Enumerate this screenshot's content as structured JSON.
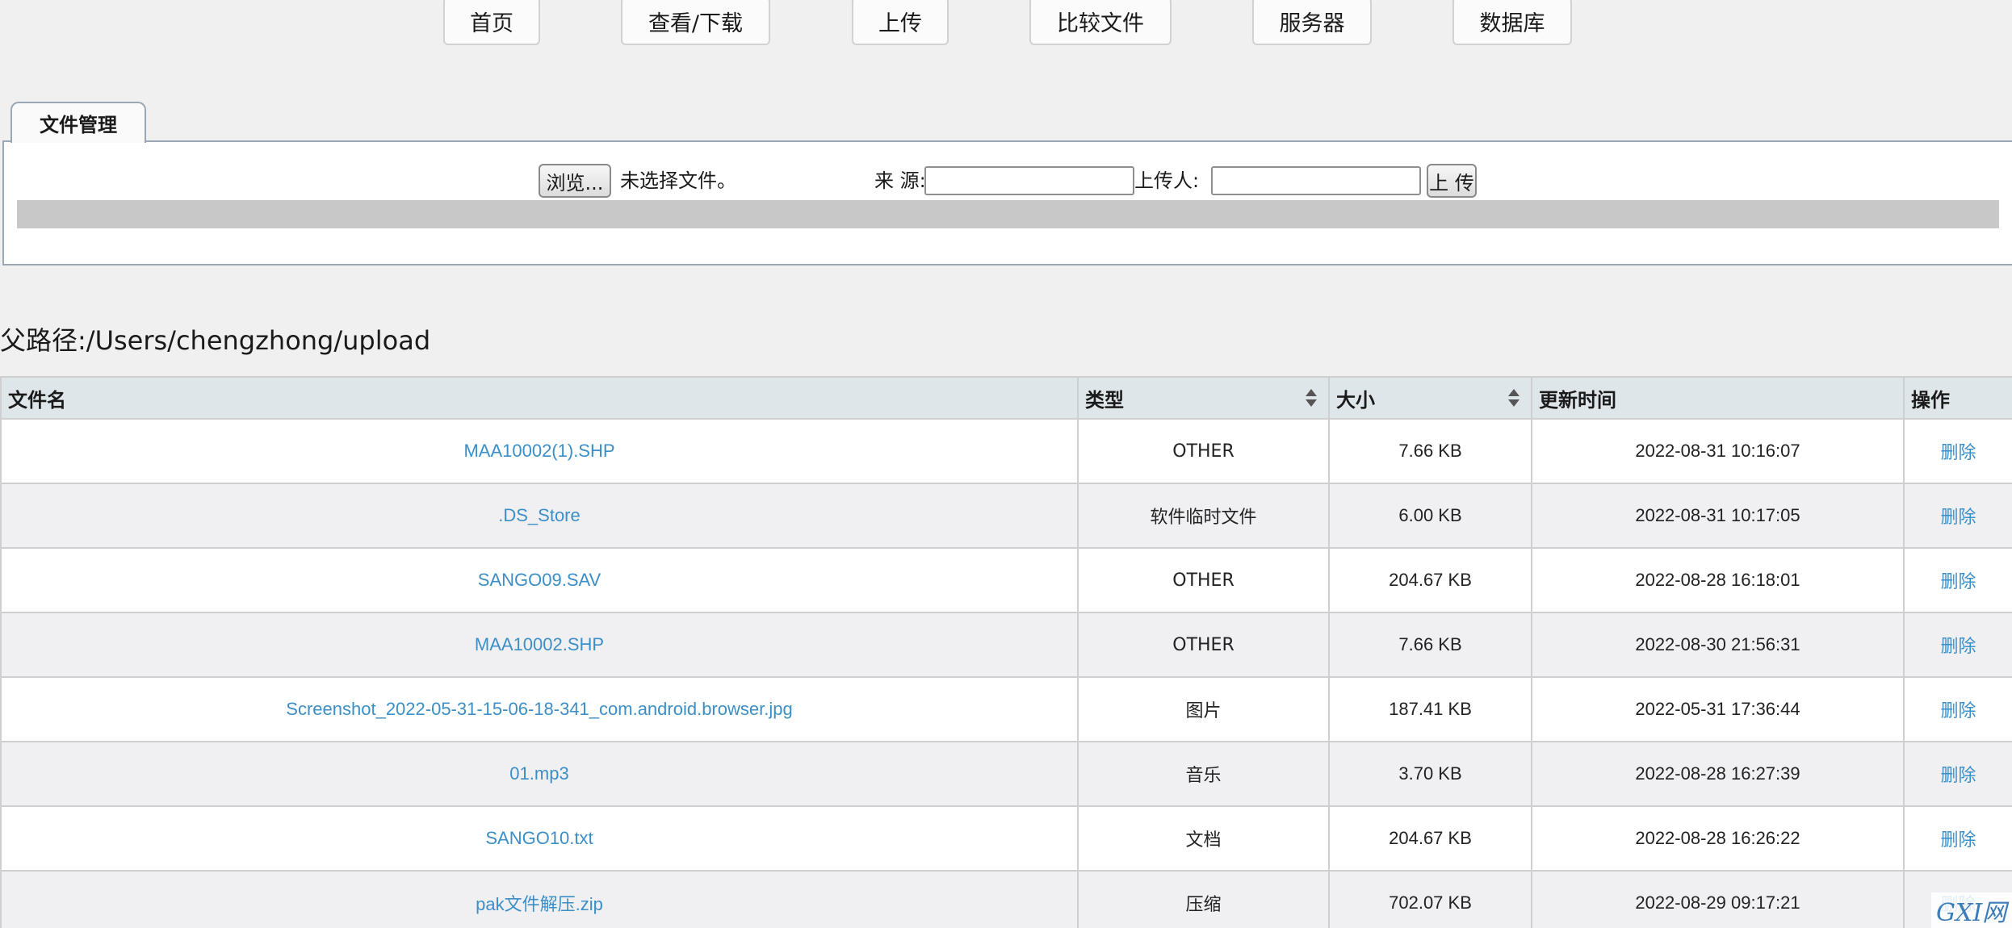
{
  "nav": {
    "items": [
      "首页",
      "查看/下载",
      "上传",
      "比较文件",
      "服务器",
      "数据库"
    ]
  },
  "tab": {
    "label": "文件管理"
  },
  "upload": {
    "browse_label": "浏览...",
    "file_status": "未选择文件。",
    "source_label": "来 源:",
    "source_value": "",
    "uploader_label": "上传人:",
    "uploader_value": "",
    "submit_label": "上 传",
    "progress": 0
  },
  "path": {
    "text": "父路径:/Users/chengzhong/upload"
  },
  "table": {
    "headers": [
      "文件名",
      "类型",
      "大小",
      "更新时间",
      "操作"
    ],
    "rows": [
      {
        "name": "MAA10002(1).SHP",
        "type": "OTHER",
        "size": "7.66 KB",
        "time": "2022-08-31 10:16:07",
        "action": "删除"
      },
      {
        "name": ".DS_Store",
        "type": "软件临时文件",
        "size": "6.00 KB",
        "time": "2022-08-31 10:17:05",
        "action": "删除"
      },
      {
        "name": "SANGO09.SAV",
        "type": "OTHER",
        "size": "204.67 KB",
        "time": "2022-08-28 16:18:01",
        "action": "删除"
      },
      {
        "name": "MAA10002.SHP",
        "type": "OTHER",
        "size": "7.66 KB",
        "time": "2022-08-30 21:56:31",
        "action": "删除"
      },
      {
        "name": "Screenshot_2022-05-31-15-06-18-341_com.android.browser.jpg",
        "type": "图片",
        "size": "187.41 KB",
        "time": "2022-05-31 17:36:44",
        "action": "删除"
      },
      {
        "name": "01.mp3",
        "type": "音乐",
        "size": "3.70 KB",
        "time": "2022-08-28 16:27:39",
        "action": "删除"
      },
      {
        "name": "SANGO10.txt",
        "type": "文档",
        "size": "204.67 KB",
        "time": "2022-08-28 16:26:22",
        "action": "删除"
      },
      {
        "name": "pak文件解压.zip",
        "type": "压缩",
        "size": "702.07 KB",
        "time": "2022-08-29 09:17:21",
        "action": "删除"
      }
    ]
  },
  "watermark": {
    "text": "GXI网"
  }
}
